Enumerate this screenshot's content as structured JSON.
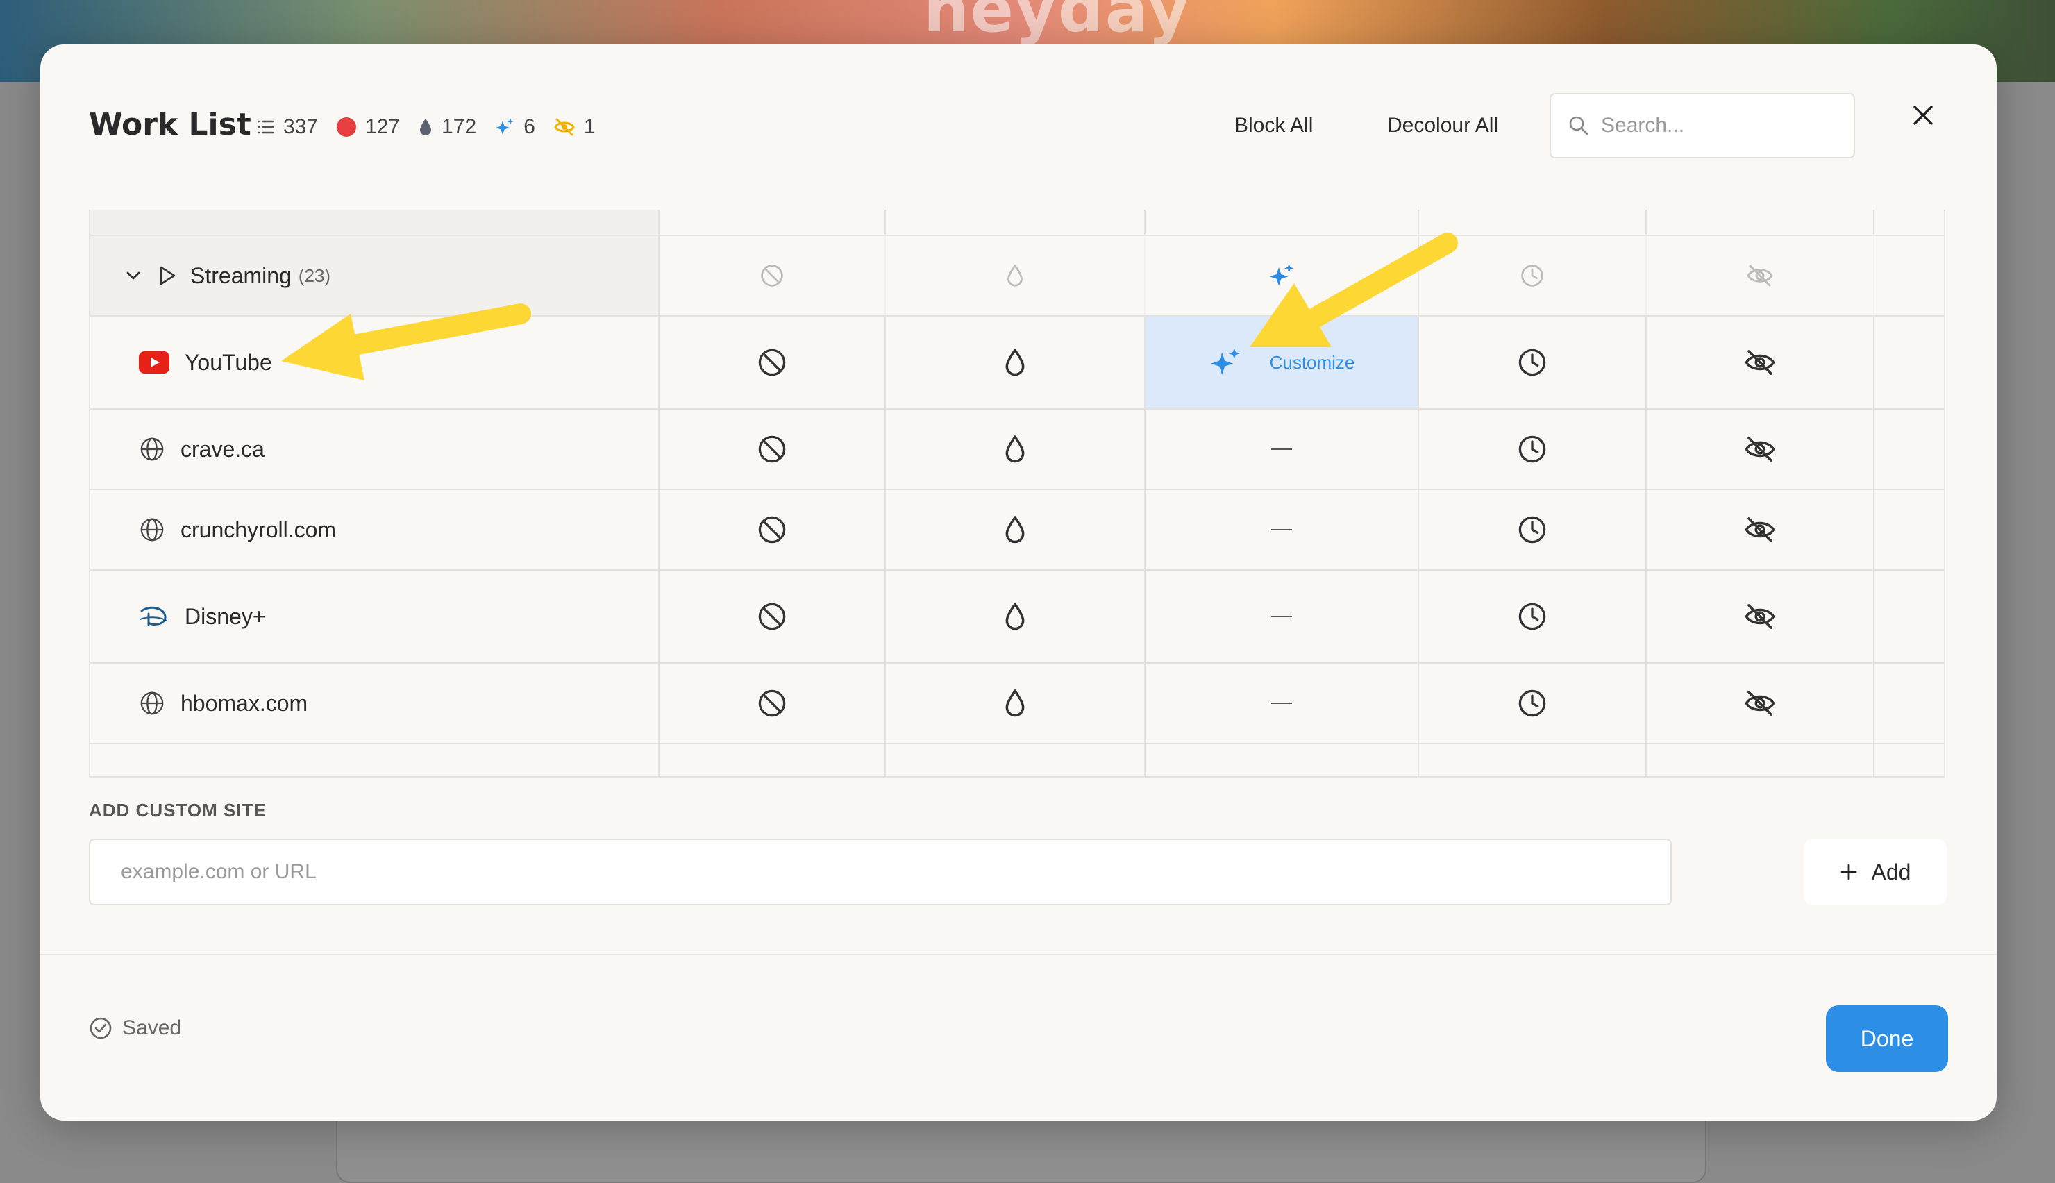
{
  "background": {
    "logo_text": "heyday"
  },
  "modal": {
    "title": "Work List",
    "stats": [
      {
        "icon": "list-icon",
        "value": "337"
      },
      {
        "icon": "red-dot-icon",
        "value": "127",
        "color": "#e84040"
      },
      {
        "icon": "drop-icon",
        "value": "172"
      },
      {
        "icon": "sparkle-icon",
        "value": "6",
        "color": "#2d8ee6"
      },
      {
        "icon": "eye-off-icon",
        "value": "1",
        "color": "#f0b400"
      }
    ],
    "block_all": "Block All",
    "decolour_all": "Decolour All",
    "search_placeholder": "Search...",
    "group": {
      "name": "Streaming",
      "count": "(23)"
    },
    "rows": [
      {
        "name": "YouTube",
        "icon": "youtube-icon",
        "customize": "Customize"
      },
      {
        "name": "crave.ca",
        "icon": "globe-icon"
      },
      {
        "name": "crunchyroll.com",
        "icon": "globe-icon"
      },
      {
        "name": "Disney+",
        "icon": "disney-icon"
      },
      {
        "name": "hbomax.com",
        "icon": "globe-icon"
      }
    ],
    "add_label": "ADD CUSTOM SITE",
    "add_placeholder": "example.com or URL",
    "add_button": "Add",
    "saved_text": "Saved",
    "done_button": "Done",
    "accent_color": "#2d8ee6",
    "annotation_color": "#fdd835"
  }
}
